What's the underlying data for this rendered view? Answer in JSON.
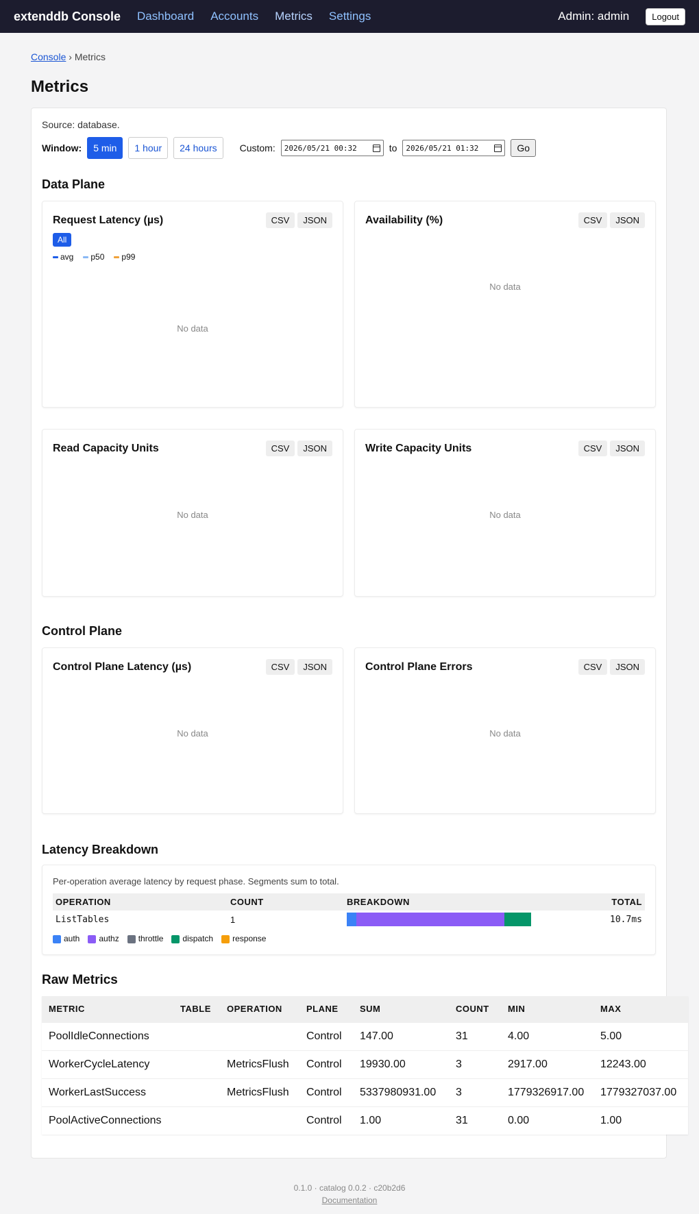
{
  "nav": {
    "brand": "extenddb Console",
    "links": [
      "Dashboard",
      "Accounts",
      "Metrics",
      "Settings"
    ],
    "admin": "Admin: admin",
    "logout": "Logout"
  },
  "breadcrumb": {
    "root": "Console",
    "sep": "›",
    "current": "Metrics"
  },
  "page_title": "Metrics",
  "source": "Source: database.",
  "window": {
    "label": "Window:",
    "options": [
      "5 min",
      "1 hour",
      "24 hours"
    ],
    "selected": "5 min",
    "custom_label": "Custom:",
    "from": "2026/05/21 00:32",
    "to_label": "to",
    "to": "2026/05/21 01:32",
    "go": "Go"
  },
  "data_plane": {
    "title": "Data Plane",
    "cards": [
      {
        "title": "Request Latency (µs)",
        "empty": "No data"
      },
      {
        "title": "Availability (%)",
        "empty": "No data"
      },
      {
        "title": "Read Capacity Units",
        "empty": "No data"
      },
      {
        "title": "Write Capacity Units",
        "empty": "No data"
      }
    ],
    "latency_filter": "All",
    "latency_legend": [
      {
        "label": "avg",
        "color": "#1e5de8"
      },
      {
        "label": "p50",
        "color": "#8ab8f5"
      },
      {
        "label": "p99",
        "color": "#f0a23a"
      }
    ]
  },
  "control_plane": {
    "title": "Control Plane",
    "cards": [
      {
        "title": "Control Plane Latency (µs)",
        "empty": "No data"
      },
      {
        "title": "Control Plane Errors",
        "empty": "No data"
      }
    ]
  },
  "export": {
    "csv": "CSV",
    "json": "JSON"
  },
  "latency_breakdown": {
    "title": "Latency Breakdown",
    "description": "Per-operation average latency by request phase. Segments sum to total.",
    "headers": [
      "OPERATION",
      "COUNT",
      "BREAKDOWN",
      "TOTAL"
    ],
    "rows": [
      {
        "operation": "ListTables",
        "count": "1",
        "total": "10.7ms",
        "segments": [
          {
            "phase": "auth",
            "fraction": 0.05
          },
          {
            "phase": "authz",
            "fraction": 0.78
          },
          {
            "phase": "throttle",
            "fraction": 0.0
          },
          {
            "phase": "dispatch",
            "fraction": 0.14
          },
          {
            "phase": "response",
            "fraction": 0.0
          }
        ]
      }
    ],
    "legend": [
      {
        "label": "auth",
        "color": "#3b82f6"
      },
      {
        "label": "authz",
        "color": "#8b5cf6"
      },
      {
        "label": "throttle",
        "color": "#6b7280"
      },
      {
        "label": "dispatch",
        "color": "#059669"
      },
      {
        "label": "response",
        "color": "#f59e0b"
      }
    ]
  },
  "raw_metrics": {
    "title": "Raw Metrics",
    "headers": [
      "METRIC",
      "TABLE",
      "OPERATION",
      "PLANE",
      "SUM",
      "COUNT",
      "MIN",
      "MAX"
    ],
    "rows": [
      [
        "PoolIdleConnections",
        "",
        "",
        "Control",
        "147.00",
        "31",
        "4.00",
        "5.00"
      ],
      [
        "WorkerCycleLatency",
        "",
        "MetricsFlush",
        "Control",
        "19930.00",
        "3",
        "2917.00",
        "12243.00"
      ],
      [
        "WorkerLastSuccess",
        "",
        "MetricsFlush",
        "Control",
        "5337980931.00",
        "3",
        "1779326917.00",
        "1779327037.00"
      ],
      [
        "PoolActiveConnections",
        "",
        "",
        "Control",
        "1.00",
        "31",
        "0.00",
        "1.00"
      ]
    ]
  },
  "footer": {
    "version": "0.1.0 · catalog 0.0.2 · c20b2d6",
    "docs": "Documentation"
  }
}
